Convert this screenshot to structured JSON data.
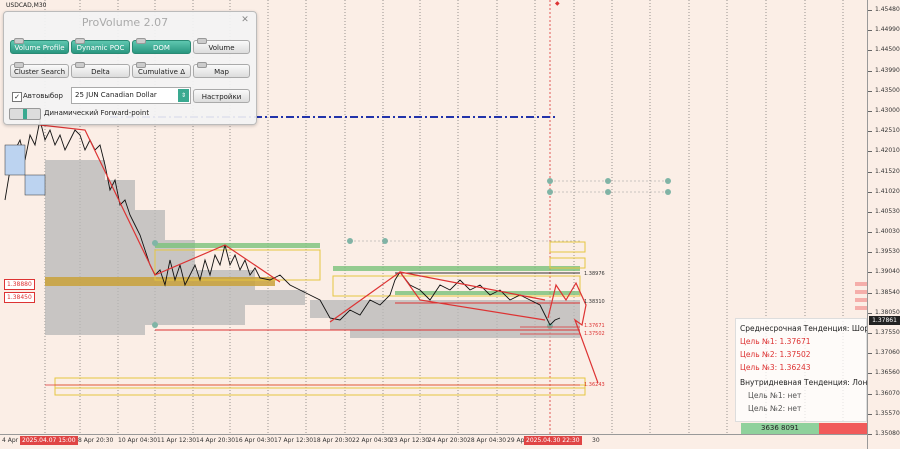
{
  "symbol": "USDCAD,M30",
  "panel": {
    "title": "ProVolume 2.07",
    "close_label": "✕",
    "buttons": [
      {
        "label": "Volume Profile",
        "active": true
      },
      {
        "label": "Dynamic POC",
        "active": true
      },
      {
        "label": "DOM",
        "active": true
      },
      {
        "label": "Volume",
        "active": false
      },
      {
        "label": "Cluster Search",
        "active": false
      },
      {
        "label": "Delta",
        "active": false
      },
      {
        "label": "Cumulative Δ",
        "active": false
      },
      {
        "label": "Map",
        "active": false
      }
    ],
    "auto_select_label": "Автовыбор",
    "auto_select_checked": "✓",
    "instrument_select": "25 JUN Canadian Dollar",
    "settings_button": "Настройки",
    "dynamic_label": "Динамический Forward-point"
  },
  "price_axis": [
    "1.45480",
    "1.44990",
    "1.44500",
    "1.43990",
    "1.43500",
    "1.43000",
    "1.42510",
    "1.42010",
    "1.41520",
    "1.41020",
    "1.40530",
    "1.40030",
    "1.39530",
    "1.39040",
    "1.38540",
    "1.38050",
    "1.37550",
    "1.37060",
    "1.36560",
    "1.36070",
    "1.35570",
    "1.35080"
  ],
  "current_price": "1.37861",
  "left_levels": [
    "1.38880",
    "1.38450"
  ],
  "right_levels": [
    "1.38976",
    "1.38310",
    "1.37671",
    "1.37502",
    "1.36243"
  ],
  "time_axis": [
    "4 Apr",
    "2025.04.07 15:00",
    "8 Apr 20:30",
    "10 Apr 04:30",
    "11 Apr 12:30",
    "14 Apr 20:30",
    "16 Apr 04:30",
    "17 Apr 12:30",
    "18 Apr 20:30",
    "22 Apr 04:30",
    "23 Apr 12:30",
    "24 Apr 20:30",
    "28 Apr 04:30",
    "29 Apr",
    "2025.04.30 22:30",
    "30"
  ],
  "trend": {
    "medium_title": "Среднесрочная Тенденция: Шорт",
    "target1_label": "Цель №1:",
    "target1_value": "1.37671",
    "target2_label": "Цель №2:",
    "target2_value": "1.37502",
    "target3_label": "Цель №3:",
    "target3_value": "1.36243",
    "intraday_title": "Внутридневная Тенденция: Лонг",
    "intra1": "Цель №1:  нет",
    "intra2": "Цель №2:  нет"
  },
  "bottom_bar": "3636 8091",
  "colors": {
    "background": "#fbeee6",
    "accent": "#3aa990",
    "short": "#d33",
    "long": "#2a7"
  }
}
